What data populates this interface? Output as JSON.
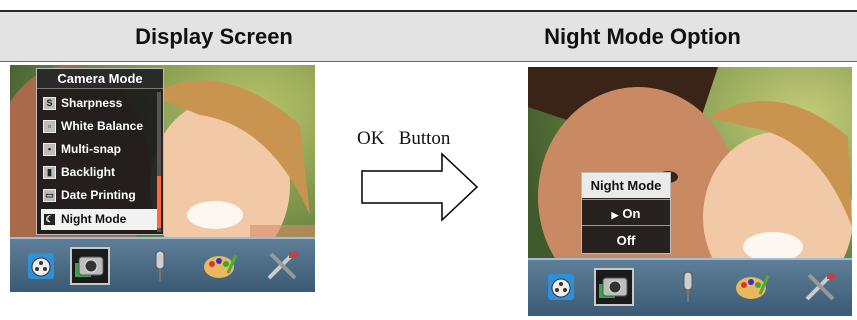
{
  "header": {
    "left_title": "Display Screen",
    "right_title": "Night Mode Option"
  },
  "left_screen": {
    "menu_title": "Camera Mode",
    "items": [
      {
        "label": "Sharpness",
        "icon": "sharpness-icon",
        "glyph": "S"
      },
      {
        "label": "White Balance",
        "icon": "white-balance-icon",
        "glyph": "▫"
      },
      {
        "label": "Multi-snap",
        "icon": "multi-snap-icon",
        "glyph": "▪"
      },
      {
        "label": "Backlight",
        "icon": "backlight-icon",
        "glyph": "▮"
      },
      {
        "label": "Date Printing",
        "icon": "date-printing-icon",
        "glyph": "▭"
      },
      {
        "label": "Night Mode",
        "icon": "night-mode-icon",
        "glyph": "☾"
      }
    ],
    "selected_index": 5
  },
  "toolbar_icons": [
    "movie-reel-icon",
    "camera-icon",
    "microphone-icon",
    "palette-icon",
    "tools-icon"
  ],
  "toolbar_active_index": 1,
  "middle": {
    "ok_text": "OK",
    "button_text": "Button"
  },
  "right_screen": {
    "popup_title": "Night Mode",
    "options": [
      {
        "label": "On",
        "selected": true
      },
      {
        "label": "Off",
        "selected": false
      }
    ],
    "selected_marker": "▶"
  },
  "colors": {
    "header_bg": "#e3e3e3",
    "toolbar_top": "#5f7f98",
    "toolbar_bottom": "#3a5a75",
    "scroll_thumb": "#ff6a3d"
  }
}
